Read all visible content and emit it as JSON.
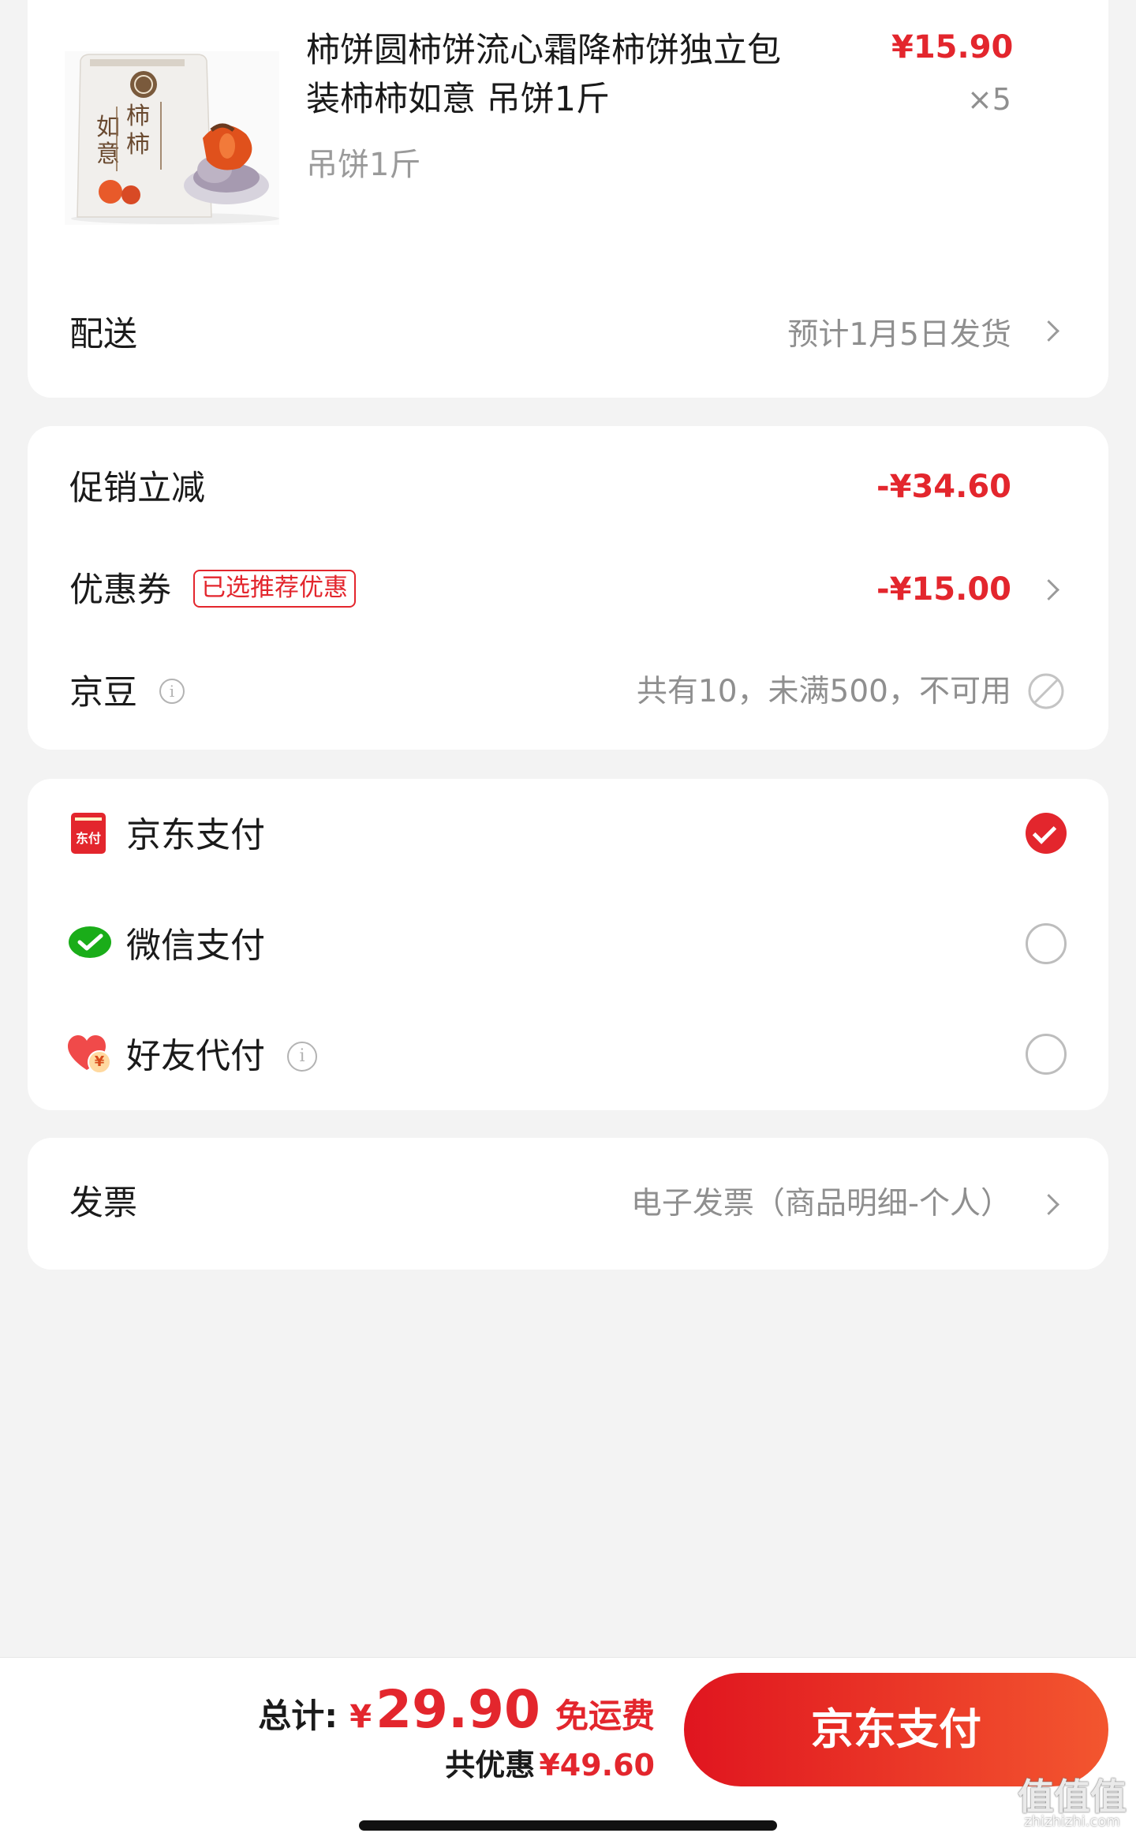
{
  "product": {
    "title_line1": "柿饼圆柿饼流心霜降柿饼独立包",
    "title_line2": "装柿柿如意 吊饼1斤",
    "spec": "吊饼1斤",
    "price": "¥15.90",
    "quantity": "×5",
    "package_text": "柿柿如意"
  },
  "delivery": {
    "label": "配送",
    "value": "预计1月5日发货"
  },
  "discounts": {
    "promo_label": "促销立减",
    "promo_value": "-¥34.60",
    "coupon_label": "优惠券",
    "coupon_badge": "已选推荐优惠",
    "coupon_value": "-¥15.00",
    "jingdou_label": "京豆",
    "jingdou_value": "共有10，未满500，不可用"
  },
  "payment": {
    "options": [
      {
        "label": "京东支付",
        "icon": "jd-pay-icon",
        "icon_text": "东付",
        "selected": true
      },
      {
        "label": "微信支付",
        "icon": "wechat-pay-icon",
        "selected": false
      },
      {
        "label": "好友代付",
        "icon": "friend-pay-icon",
        "icon_text": "¥",
        "selected": false
      }
    ]
  },
  "invoice": {
    "label": "发票",
    "value": "电子发票（商品明细-个人）"
  },
  "footer": {
    "total_label": "总计:",
    "total_currency": "¥",
    "total_amount": "29.90",
    "shipping": "免运费",
    "saved_label": "共优惠",
    "saved_amount": "¥49.60",
    "pay_button": "京东支付"
  },
  "watermark": {
    "text": "值值值",
    "sub": "zhizhizhi.com"
  },
  "colors": {
    "accent": "#e3262d",
    "button_start": "#e0151f",
    "button_end": "#f3562f",
    "muted": "#8f8f8f",
    "background": "#f3f3f3"
  }
}
